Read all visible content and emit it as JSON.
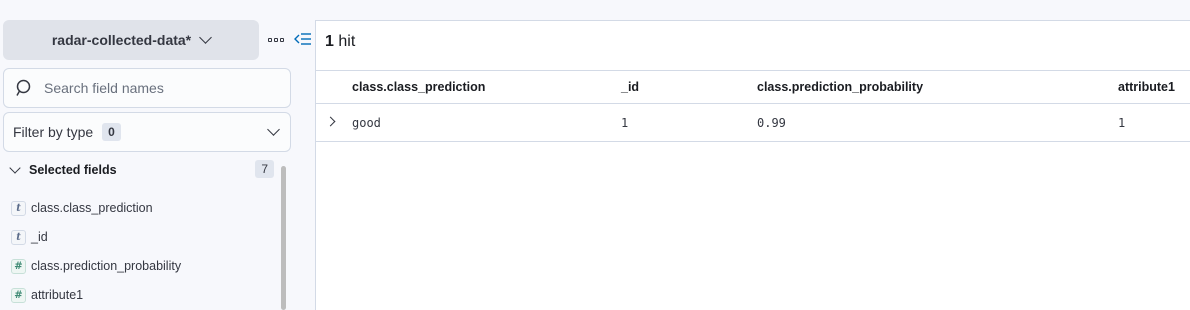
{
  "sidebar": {
    "data_view": "radar-collected-data*",
    "search": {
      "placeholder": "Search field names",
      "value": ""
    },
    "filter": {
      "label": "Filter by type",
      "count": "0"
    },
    "selected": {
      "title": "Selected fields",
      "count": "7",
      "fields": [
        {
          "name": "class.class_prediction",
          "type": "t"
        },
        {
          "name": "_id",
          "type": "t"
        },
        {
          "name": "class.prediction_probability",
          "type": "#"
        },
        {
          "name": "attribute1",
          "type": "#"
        }
      ]
    },
    "icons": {
      "dots": "panel-options-icon",
      "collapse": "collapse-sidebar-icon"
    }
  },
  "main": {
    "hits_count": "1",
    "hits_label": "hit",
    "columns": [
      "class.class_prediction",
      "_id",
      "class.prediction_probability",
      "attribute1"
    ],
    "rows": [
      [
        "good",
        "1",
        "0.99",
        "1"
      ]
    ]
  },
  "colors": {
    "accent": "#006bb8",
    "border": "#d3dae6",
    "panel": "#e0e3ea"
  }
}
